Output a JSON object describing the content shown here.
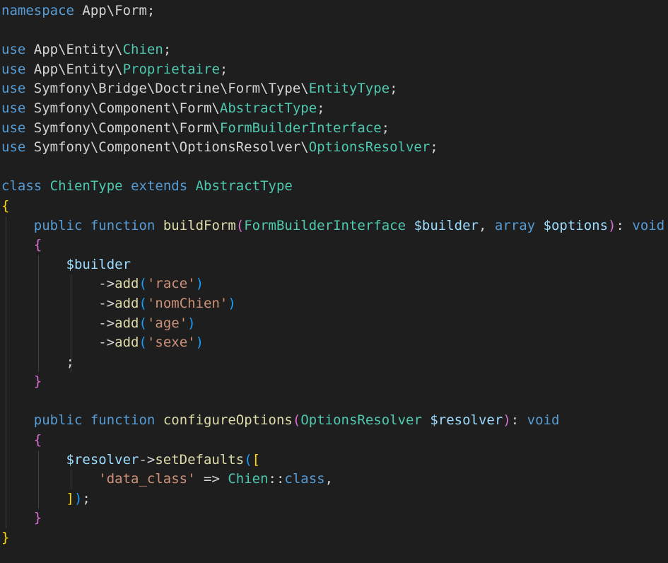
{
  "editor": {
    "language": "php",
    "theme": "dark",
    "colors": {
      "background": "#1e1e1e",
      "keyword": "#569cd6",
      "namespace": "#d4d4d4",
      "type": "#4ec9b0",
      "function": "#dcdcaa",
      "variable": "#9cdcfe",
      "string": "#ce9178",
      "punctuation": "#d4d4d4",
      "bracket_gold": "#ffd700",
      "bracket_purple": "#da70d6",
      "bracket_blue": "#179fff",
      "indent_guide": "#404040"
    },
    "lines": [
      {
        "guides": [],
        "tokens": [
          {
            "t": "namespace",
            "c": "keyword"
          },
          {
            "t": " App\\Form;",
            "c": "namespace"
          }
        ]
      },
      {
        "guides": [],
        "tokens": []
      },
      {
        "guides": [],
        "tokens": [
          {
            "t": "use",
            "c": "keyword"
          },
          {
            "t": " App\\Entity\\",
            "c": "namespace"
          },
          {
            "t": "Chien",
            "c": "type"
          },
          {
            "t": ";",
            "c": "punctuation"
          }
        ]
      },
      {
        "guides": [],
        "tokens": [
          {
            "t": "use",
            "c": "keyword"
          },
          {
            "t": " App\\Entity\\",
            "c": "namespace"
          },
          {
            "t": "Proprietaire",
            "c": "type"
          },
          {
            "t": ";",
            "c": "punctuation"
          }
        ]
      },
      {
        "guides": [],
        "tokens": [
          {
            "t": "use",
            "c": "keyword"
          },
          {
            "t": " Symfony\\Bridge\\Doctrine\\Form\\Type\\",
            "c": "namespace"
          },
          {
            "t": "EntityType",
            "c": "type"
          },
          {
            "t": ";",
            "c": "punctuation"
          }
        ]
      },
      {
        "guides": [],
        "tokens": [
          {
            "t": "use",
            "c": "keyword"
          },
          {
            "t": " Symfony\\Component\\Form\\",
            "c": "namespace"
          },
          {
            "t": "AbstractType",
            "c": "type"
          },
          {
            "t": ";",
            "c": "punctuation"
          }
        ]
      },
      {
        "guides": [],
        "tokens": [
          {
            "t": "use",
            "c": "keyword"
          },
          {
            "t": " Symfony\\Component\\Form\\",
            "c": "namespace"
          },
          {
            "t": "FormBuilderInterface",
            "c": "type"
          },
          {
            "t": ";",
            "c": "punctuation"
          }
        ]
      },
      {
        "guides": [],
        "tokens": [
          {
            "t": "use",
            "c": "keyword"
          },
          {
            "t": " Symfony\\Component\\OptionsResolver\\",
            "c": "namespace"
          },
          {
            "t": "OptionsResolver",
            "c": "type"
          },
          {
            "t": ";",
            "c": "punctuation"
          }
        ]
      },
      {
        "guides": [],
        "tokens": []
      },
      {
        "guides": [],
        "tokens": [
          {
            "t": "class",
            "c": "keyword"
          },
          {
            "t": " ",
            "c": "punctuation"
          },
          {
            "t": "ChienType",
            "c": "type"
          },
          {
            "t": " ",
            "c": "punctuation"
          },
          {
            "t": "extends",
            "c": "keyword"
          },
          {
            "t": " ",
            "c": "punctuation"
          },
          {
            "t": "AbstractType",
            "c": "type"
          }
        ]
      },
      {
        "guides": [],
        "tokens": [
          {
            "t": "{",
            "c": "bracket_gold"
          }
        ]
      },
      {
        "guides": [
          1
        ],
        "tokens": [
          {
            "t": "    ",
            "c": "punctuation"
          },
          {
            "t": "public",
            "c": "keyword"
          },
          {
            "t": " ",
            "c": "punctuation"
          },
          {
            "t": "function",
            "c": "keyword"
          },
          {
            "t": " ",
            "c": "punctuation"
          },
          {
            "t": "buildForm",
            "c": "function"
          },
          {
            "t": "(",
            "c": "bracket_purple"
          },
          {
            "t": "FormBuilderInterface",
            "c": "type"
          },
          {
            "t": " ",
            "c": "punctuation"
          },
          {
            "t": "$builder",
            "c": "variable"
          },
          {
            "t": ", ",
            "c": "punctuation"
          },
          {
            "t": "array",
            "c": "keyword"
          },
          {
            "t": " ",
            "c": "punctuation"
          },
          {
            "t": "$options",
            "c": "variable"
          },
          {
            "t": ")",
            "c": "bracket_purple"
          },
          {
            "t": ": ",
            "c": "punctuation"
          },
          {
            "t": "void",
            "c": "keyword"
          }
        ]
      },
      {
        "guides": [
          1
        ],
        "tokens": [
          {
            "t": "    ",
            "c": "punctuation"
          },
          {
            "t": "{",
            "c": "bracket_purple"
          }
        ]
      },
      {
        "guides": [
          1,
          2
        ],
        "tokens": [
          {
            "t": "        ",
            "c": "punctuation"
          },
          {
            "t": "$builder",
            "c": "variable"
          }
        ]
      },
      {
        "guides": [
          1,
          2,
          3
        ],
        "tokens": [
          {
            "t": "            ",
            "c": "punctuation"
          },
          {
            "t": "->",
            "c": "punctuation"
          },
          {
            "t": "add",
            "c": "function"
          },
          {
            "t": "(",
            "c": "bracket_blue"
          },
          {
            "t": "'race'",
            "c": "string"
          },
          {
            "t": ")",
            "c": "bracket_blue"
          }
        ]
      },
      {
        "guides": [
          1,
          2,
          3
        ],
        "tokens": [
          {
            "t": "            ",
            "c": "punctuation"
          },
          {
            "t": "->",
            "c": "punctuation"
          },
          {
            "t": "add",
            "c": "function"
          },
          {
            "t": "(",
            "c": "bracket_blue"
          },
          {
            "t": "'nomChien'",
            "c": "string"
          },
          {
            "t": ")",
            "c": "bracket_blue"
          }
        ]
      },
      {
        "guides": [
          1,
          2,
          3
        ],
        "tokens": [
          {
            "t": "            ",
            "c": "punctuation"
          },
          {
            "t": "->",
            "c": "punctuation"
          },
          {
            "t": "add",
            "c": "function"
          },
          {
            "t": "(",
            "c": "bracket_blue"
          },
          {
            "t": "'age'",
            "c": "string"
          },
          {
            "t": ")",
            "c": "bracket_blue"
          }
        ]
      },
      {
        "guides": [
          1,
          2,
          3
        ],
        "tokens": [
          {
            "t": "            ",
            "c": "punctuation"
          },
          {
            "t": "->",
            "c": "punctuation"
          },
          {
            "t": "add",
            "c": "function"
          },
          {
            "t": "(",
            "c": "bracket_blue"
          },
          {
            "t": "'sexe'",
            "c": "string"
          },
          {
            "t": ")",
            "c": "bracket_blue"
          }
        ]
      },
      {
        "guides": [
          1,
          2,
          3
        ],
        "tokens": [
          {
            "t": "        ",
            "c": "punctuation"
          },
          {
            "t": ";",
            "c": "punctuation"
          }
        ]
      },
      {
        "guides": [
          1
        ],
        "tokens": [
          {
            "t": "    ",
            "c": "punctuation"
          },
          {
            "t": "}",
            "c": "bracket_purple"
          }
        ]
      },
      {
        "guides": [
          1
        ],
        "tokens": []
      },
      {
        "guides": [
          1
        ],
        "tokens": [
          {
            "t": "    ",
            "c": "punctuation"
          },
          {
            "t": "public",
            "c": "keyword"
          },
          {
            "t": " ",
            "c": "punctuation"
          },
          {
            "t": "function",
            "c": "keyword"
          },
          {
            "t": " ",
            "c": "punctuation"
          },
          {
            "t": "configureOptions",
            "c": "function"
          },
          {
            "t": "(",
            "c": "bracket_purple"
          },
          {
            "t": "OptionsResolver",
            "c": "type"
          },
          {
            "t": " ",
            "c": "punctuation"
          },
          {
            "t": "$resolver",
            "c": "variable"
          },
          {
            "t": ")",
            "c": "bracket_purple"
          },
          {
            "t": ": ",
            "c": "punctuation"
          },
          {
            "t": "void",
            "c": "keyword"
          }
        ]
      },
      {
        "guides": [
          1
        ],
        "tokens": [
          {
            "t": "    ",
            "c": "punctuation"
          },
          {
            "t": "{",
            "c": "bracket_purple"
          }
        ]
      },
      {
        "guides": [
          1,
          2
        ],
        "tokens": [
          {
            "t": "        ",
            "c": "punctuation"
          },
          {
            "t": "$resolver",
            "c": "variable"
          },
          {
            "t": "->",
            "c": "punctuation"
          },
          {
            "t": "setDefaults",
            "c": "function"
          },
          {
            "t": "(",
            "c": "bracket_blue"
          },
          {
            "t": "[",
            "c": "bracket_gold"
          }
        ]
      },
      {
        "guides": [
          1,
          2,
          3
        ],
        "tokens": [
          {
            "t": "            ",
            "c": "punctuation"
          },
          {
            "t": "'data_class'",
            "c": "string"
          },
          {
            "t": " => ",
            "c": "punctuation"
          },
          {
            "t": "Chien",
            "c": "type"
          },
          {
            "t": "::",
            "c": "punctuation"
          },
          {
            "t": "class",
            "c": "keyword"
          },
          {
            "t": ",",
            "c": "punctuation"
          }
        ]
      },
      {
        "guides": [
          1,
          2
        ],
        "tokens": [
          {
            "t": "        ",
            "c": "punctuation"
          },
          {
            "t": "]",
            "c": "bracket_gold"
          },
          {
            "t": ")",
            "c": "bracket_blue"
          },
          {
            "t": ";",
            "c": "punctuation"
          }
        ]
      },
      {
        "guides": [
          1
        ],
        "tokens": [
          {
            "t": "    ",
            "c": "punctuation"
          },
          {
            "t": "}",
            "c": "bracket_purple"
          }
        ]
      },
      {
        "guides": [],
        "tokens": [
          {
            "t": "}",
            "c": "bracket_gold"
          }
        ]
      }
    ]
  }
}
